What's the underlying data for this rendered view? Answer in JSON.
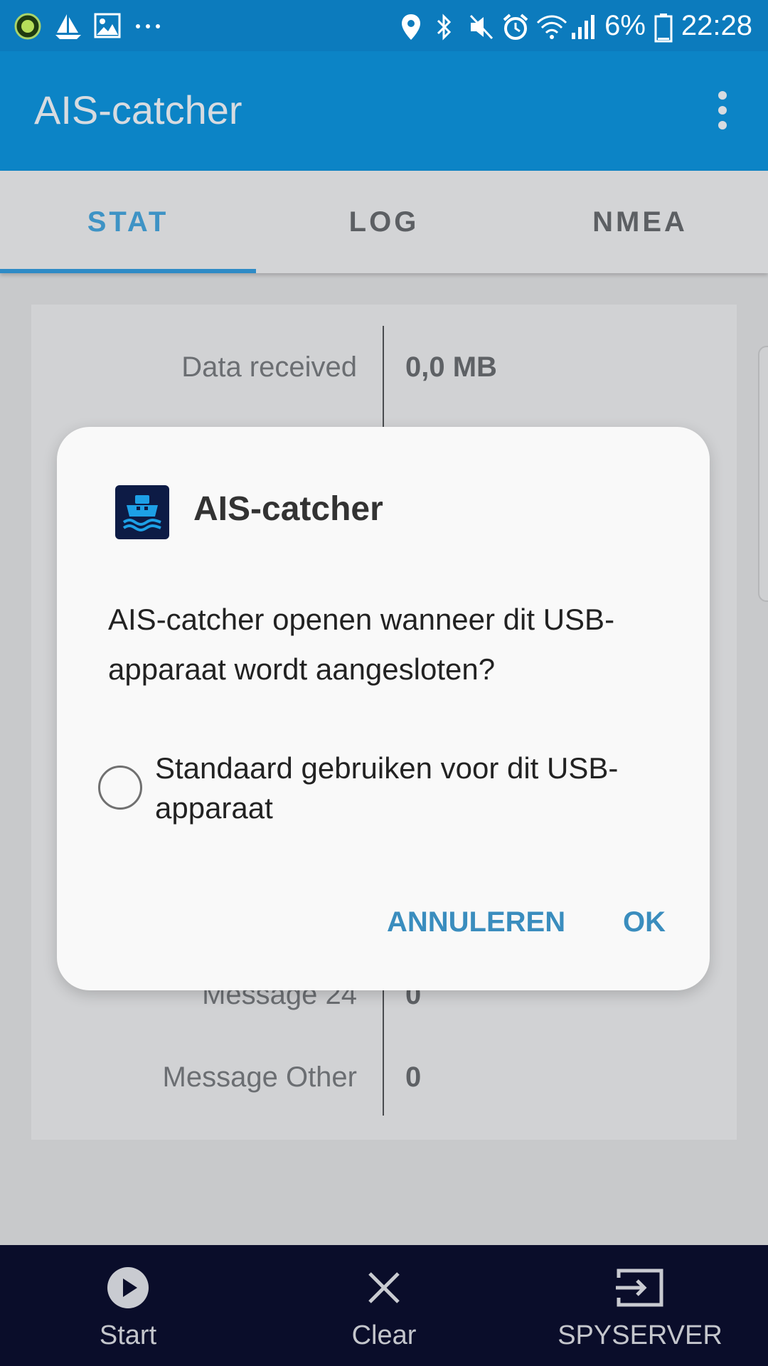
{
  "status_bar": {
    "left_icons": [
      "app-badge-icon",
      "sailboat-icon",
      "image-icon",
      "more-dots-icon"
    ],
    "right_icons": [
      "location-icon",
      "bluetooth-icon",
      "mute-icon",
      "alarm-icon",
      "wifi-icon",
      "signal-icon"
    ],
    "battery_text": "6%",
    "battery_icon": "battery-icon",
    "time": "22:28"
  },
  "app_bar": {
    "title": "AIS-catcher",
    "menu_icon": "overflow-menu-icon"
  },
  "tabs": [
    {
      "label": "STAT",
      "active": true
    },
    {
      "label": "LOG",
      "active": false
    },
    {
      "label": "NMEA",
      "active": false
    }
  ],
  "stats": [
    {
      "label": "Data received",
      "value": "0,0 MB"
    },
    {
      "label": "Message 24",
      "value": "0"
    },
    {
      "label": "Message Other",
      "value": "0"
    }
  ],
  "dialog": {
    "app_icon": "ship-icon",
    "title": "AIS-catcher",
    "message": "AIS-catcher openen wanneer dit USB-apparaat wordt aangesloten?",
    "checkbox_label": "Standaard gebruiken voor dit USB-apparaat",
    "checkbox_checked": false,
    "cancel_label": "ANNULEREN",
    "ok_label": "OK"
  },
  "bottom_nav": [
    {
      "label": "Start",
      "icon": "play-icon"
    },
    {
      "label": "Clear",
      "icon": "close-icon"
    },
    {
      "label": "SPYSERVER",
      "icon": "input-icon"
    }
  ],
  "colors": {
    "primary": "#0c84c6",
    "status_bar": "#0c7bbd",
    "accent": "#3a8dbe",
    "bottom_nav_bg": "#0a0d2a"
  }
}
